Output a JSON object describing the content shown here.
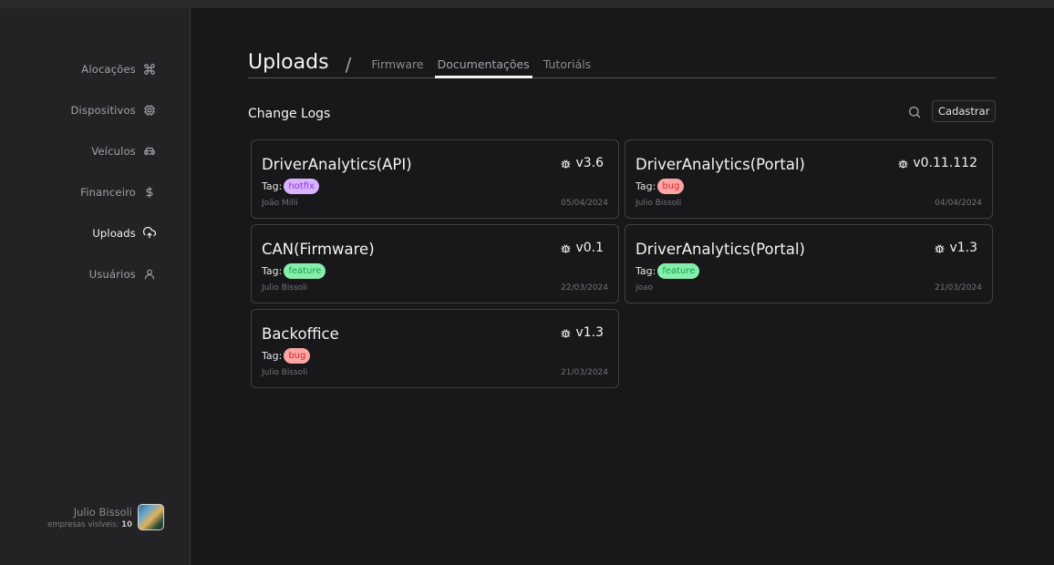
{
  "sidebar": {
    "items": [
      {
        "label": "Alocações",
        "icon": "command-icon",
        "active": false
      },
      {
        "label": "Dispositivos",
        "icon": "chip-icon",
        "active": false
      },
      {
        "label": "Veículos",
        "icon": "car-icon",
        "active": false
      },
      {
        "label": "Financeiro",
        "icon": "dollar-icon",
        "active": false
      },
      {
        "label": "Uploads",
        "icon": "cloud-upload-icon",
        "active": true
      },
      {
        "label": "Usuários",
        "icon": "user-icon",
        "active": false
      }
    ],
    "user": {
      "name": "Julio Bissoli",
      "companies_label": "empresas visíveis:",
      "companies_count": "10"
    }
  },
  "header": {
    "title": "Uploads",
    "separator": "/",
    "tabs": [
      {
        "label": "Firmware",
        "active": false
      },
      {
        "label": "Documentações",
        "active": true
      },
      {
        "label": "Tutoriáls",
        "active": false
      }
    ]
  },
  "section": {
    "title": "Change Logs",
    "add_button": "Cadastrar"
  },
  "cards": [
    {
      "title": "DriverAnalytics(API)",
      "version": "v3.6",
      "tag_label": "Tag:",
      "tag": "hotfix",
      "author": "João Milli",
      "date": "05/04/2024"
    },
    {
      "title": "DriverAnalytics(Portal)",
      "version": "v0.11.112",
      "tag_label": "Tag:",
      "tag": "bug",
      "author": "Julio Bissoli",
      "date": "04/04/2024"
    },
    {
      "title": "CAN(Firmware)",
      "version": "v0.1",
      "tag_label": "Tag:",
      "tag": "feature",
      "author": "Julio Bissoli",
      "date": "22/03/2024"
    },
    {
      "title": "DriverAnalytics(Portal)",
      "version": "v1.3",
      "tag_label": "Tag:",
      "tag": "feature",
      "author": "joao",
      "date": "21/03/2024"
    },
    {
      "title": "Backoffice",
      "version": "v1.3",
      "tag_label": "Tag:",
      "tag": "bug",
      "author": "Julio Bissoli",
      "date": "21/03/2024"
    }
  ],
  "colors": {
    "background": "#18181b",
    "sidebar": "#232326",
    "tag_hotfix": "#d8b4fe",
    "tag_bug": "#fca5a5",
    "tag_feature": "#86efac"
  }
}
